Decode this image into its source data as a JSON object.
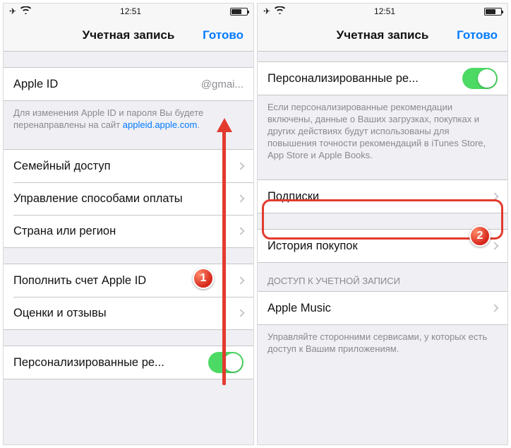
{
  "status": {
    "time": "12:51"
  },
  "nav": {
    "title": "Учетная запись",
    "done": "Готово"
  },
  "left": {
    "appleIdLabel": "Apple ID",
    "appleIdValue": "@gmai...",
    "appleIdFooter": "Для изменения Apple ID и пароля Вы будете перенаправлены на сайт ",
    "appleIdLink": "appleid.apple.com",
    "family": "Семейный доступ",
    "payment": "Управление способами оплаты",
    "region": "Страна или регион",
    "topup": "Пополнить счет Apple ID",
    "reviews": "Оценки и отзывы",
    "personalized": "Персонализированные ре..."
  },
  "right": {
    "personalized": "Персонализированные ре...",
    "personalizedFooter": "Если персонализированные рекомендации включены, данные о Ваших загрузках, покупках и других действиях будут использованы для повышения точности рекомендаций в iTunes Store, App Store и Apple Books.",
    "subscriptions": "Подписки",
    "purchaseHistory": "История покупок",
    "accessHeader": "ДОСТУП К УЧЕТНОЙ ЗАПИСИ",
    "appleMusic": "Apple Music",
    "accessFooter": "Управляйте сторонними сервисами, у которых есть доступ к Вашим приложениям."
  },
  "annotations": {
    "badge1": "1",
    "badge2": "2"
  }
}
